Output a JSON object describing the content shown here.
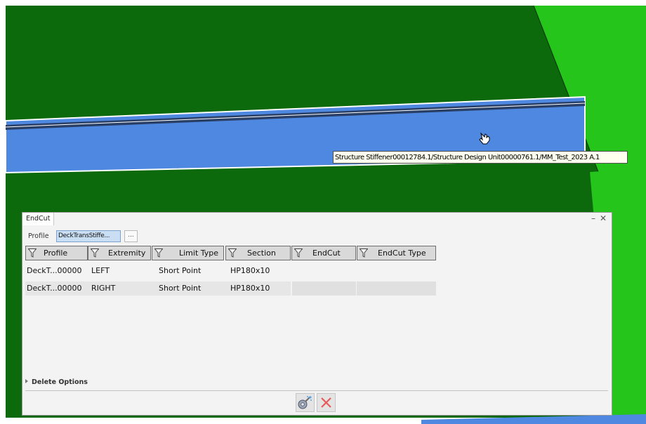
{
  "tooltip": {
    "text": "Structure Stiffener00012784.1/Structure Design Unit00000761.1/MM_Test_2023 A.1"
  },
  "panel": {
    "title": "EndCut",
    "minimize_icon": "minimize-icon",
    "close_icon": "close-icon"
  },
  "profile": {
    "label": "Profile",
    "value": "DeckTransStiffe...",
    "browse_label": "..."
  },
  "grid": {
    "columns": [
      "Profile",
      "Extremity",
      "Limit Type",
      "Section",
      "EndCut",
      "EndCut Type"
    ],
    "rows": [
      {
        "profile": "DeckT...00000",
        "extremity": "LEFT",
        "limit_type": "Short Point",
        "section": "HP180x10",
        "endcut": "",
        "endcut_type": ""
      },
      {
        "profile": "DeckT...00000",
        "extremity": "RIGHT",
        "limit_type": "Short Point",
        "section": "HP180x10",
        "endcut": "",
        "endcut_type": ""
      }
    ]
  },
  "delete_options": {
    "label": "Delete Options"
  },
  "actions": {
    "apply_icon": "apply-magic-wand-icon",
    "cancel_icon": "cancel-x-icon"
  },
  "colors": {
    "background_green": "#0c6a0c",
    "bright_green": "#25c51c",
    "stiffener_blue": "#4e88e0",
    "panel_bg": "#f3f3f3",
    "header_bg": "#d9d9d9"
  }
}
